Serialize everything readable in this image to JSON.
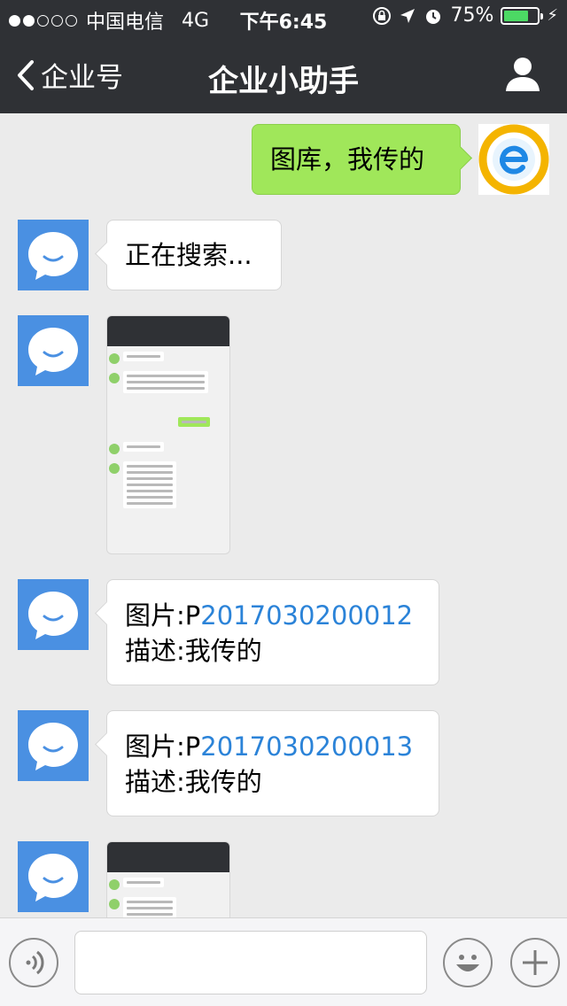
{
  "status_bar": {
    "carrier": "中国电信",
    "network": "4G",
    "time": "下午6:45",
    "battery_percent": "75%",
    "battery_level": 0.75,
    "signal_bars": 2,
    "signal_total": 5,
    "battery_color": "#4cd964"
  },
  "nav": {
    "back_label": "企业号",
    "title": "企业小助手",
    "profile_icon": "person-icon"
  },
  "messages": {
    "user_query": "图库，我传的",
    "searching": "正在搜索...",
    "result1": {
      "image_label": "图片:P",
      "image_id": "2017030200012",
      "desc": "描述:我传的"
    },
    "result2": {
      "image_label": "图片:P",
      "image_id": "2017030200013",
      "desc": "描述:我传的"
    }
  },
  "input": {
    "value": "",
    "voice_icon": "voice-icon",
    "emoji_icon": "emoji-icon",
    "plus_icon": "plus-icon"
  },
  "colors": {
    "bot_avatar": "#4a90e2",
    "user_bubble": "#a0e75a",
    "link": "#2b83d8",
    "nav_bg": "#2f3135"
  }
}
